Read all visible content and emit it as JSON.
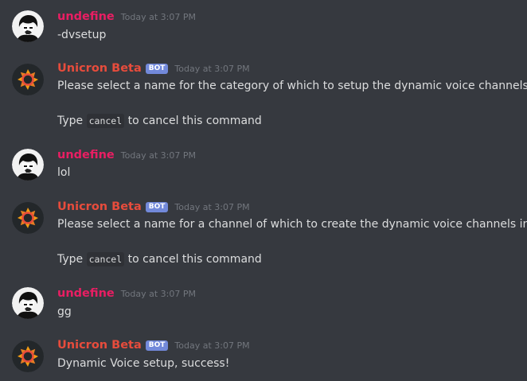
{
  "messages": [
    {
      "author": "undefine",
      "timestamp": "Today at 3:07 PM",
      "lines": [
        "-dvsetup"
      ]
    },
    {
      "author": "Unicron Beta",
      "bot_tag": "BOT",
      "timestamp": "Today at 3:07 PM",
      "line1": "Please select a name for the category of which to setup the dynamic voice channels in",
      "line2_pre": "Type",
      "line2_code": "cancel",
      "line2_post": "to cancel this command"
    },
    {
      "author": "undefine",
      "timestamp": "Today at 3:07 PM",
      "lines": [
        "lol"
      ]
    },
    {
      "author": "Unicron Beta",
      "bot_tag": "BOT",
      "timestamp": "Today at 3:07 PM",
      "line1": "Please select a name for a channel of which to create the dynamic voice channels in",
      "line2_pre": "Type",
      "line2_code": "cancel",
      "line2_post": "to cancel this command"
    },
    {
      "author": "undefine",
      "timestamp": "Today at 3:07 PM",
      "lines": [
        "gg"
      ]
    },
    {
      "author": "Unicron Beta",
      "bot_tag": "BOT",
      "timestamp": "Today at 3:07 PM",
      "lines": [
        "Dynamic Voice setup, success!"
      ]
    }
  ],
  "colors": {
    "background": "#36393f",
    "undefine_name": "#e91e63",
    "unicron_name": "#e74c3c",
    "bot_tag": "#7289da",
    "timestamp": "#72767d",
    "text": "#dcddde"
  },
  "icons": {
    "undefine_avatar": "user-avatar-icon",
    "unicron_avatar": "unicron-logo-icon"
  }
}
